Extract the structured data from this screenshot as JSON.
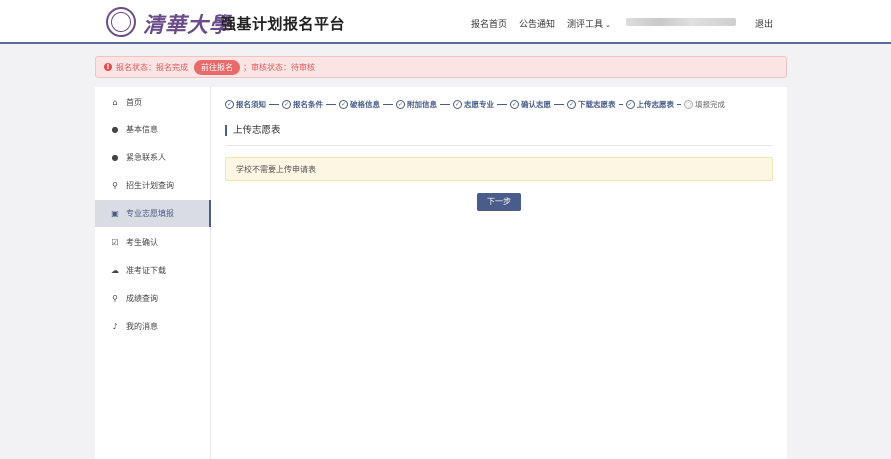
{
  "header": {
    "logo_text": "清華大學",
    "site_title": "强基计划报名平台",
    "nav": [
      "报名首页",
      "公告通知",
      "测评工具"
    ],
    "logout": "退出"
  },
  "alert": {
    "status_prefix": "报名状态：报名完成",
    "button": "前往报名",
    "review_status": "；审核状态：待审核"
  },
  "sidebar": {
    "items": [
      {
        "label": "首页",
        "icon": "home-icon"
      },
      {
        "label": "基本信息",
        "icon": "user-icon"
      },
      {
        "label": "紧急联系人",
        "icon": "user-icon"
      },
      {
        "label": "招生计划查询",
        "icon": "search-icon"
      },
      {
        "label": "专业志愿填报",
        "icon": "form-icon",
        "active": true
      },
      {
        "label": "考生确认",
        "icon": "confirm-icon"
      },
      {
        "label": "准考证下载",
        "icon": "cloud-download-icon"
      },
      {
        "label": "成绩查询",
        "icon": "search-icon"
      },
      {
        "label": "我的消息",
        "icon": "bell-icon"
      }
    ]
  },
  "steps": [
    {
      "label": "报名须知",
      "done": true
    },
    {
      "label": "报名条件",
      "done": true
    },
    {
      "label": "破格信息",
      "done": true
    },
    {
      "label": "附加信息",
      "done": true
    },
    {
      "label": "志愿专业",
      "done": true
    },
    {
      "label": "确认志愿",
      "done": true
    },
    {
      "label": "下载志愿表",
      "done": true
    },
    {
      "label": "上传志愿表",
      "done": true
    },
    {
      "label": "填报完成",
      "done": false
    }
  ],
  "content": {
    "section_title": "上传志愿表",
    "notice": "学校不需要上传申请表",
    "next_button": "下一步"
  },
  "colors": {
    "primary": "#4a5d8a",
    "alert_bg": "#fde4e4",
    "alert_text": "#e05a5a",
    "notice_bg": "#fdf6e3"
  }
}
